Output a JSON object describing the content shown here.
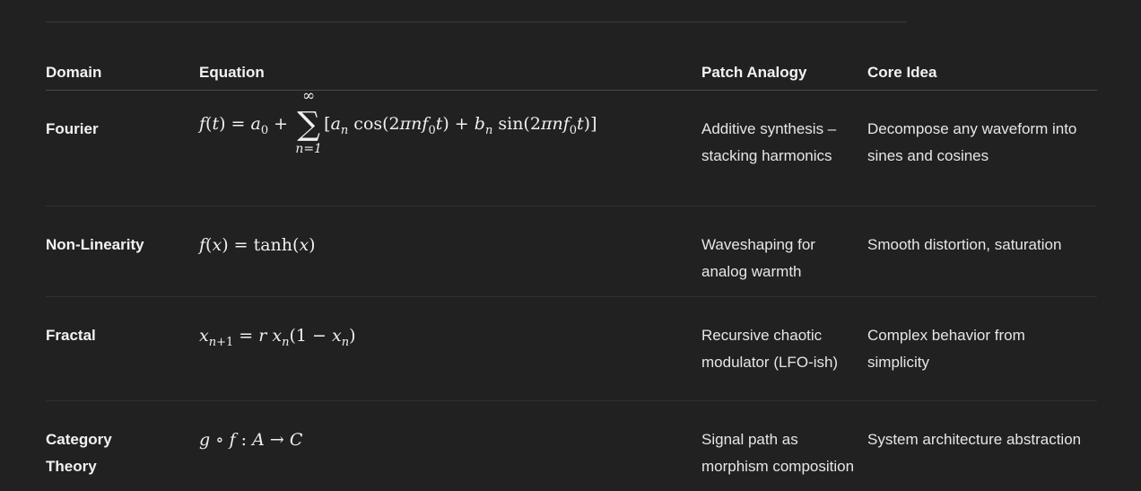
{
  "table": {
    "headers": {
      "domain": "Domain",
      "equation": "Equation",
      "patch": "Patch Analogy",
      "idea": "Core Idea"
    },
    "rows": [
      {
        "domain": "Fourier",
        "equation": "f(t) = a_0 + Σ_{n=1}^{∞} [a_n cos(2πn f_0 t) + b_n sin(2πn f_0 t)]",
        "patch": "Additive synthesis – stacking harmonics",
        "idea": "Decompose any waveform into sines and cosines"
      },
      {
        "domain": "Non-Linearity",
        "equation": "f(x) = tanh(x)",
        "patch": "Waveshaping for analog warmth",
        "idea": "Smooth distortion, saturation"
      },
      {
        "domain": "Fractal",
        "equation": "x_{n+1} = r x_n(1 − x_n)",
        "patch": "Recursive chaotic modulator (LFO-ish)",
        "idea": "Complex behavior from simplicity"
      },
      {
        "domain_line1": "Category",
        "domain_line2": "Theory",
        "equation": "g ∘ f : A → C",
        "patch": "Signal path as morphism composition",
        "idea": "System architecture abstraction"
      }
    ]
  }
}
